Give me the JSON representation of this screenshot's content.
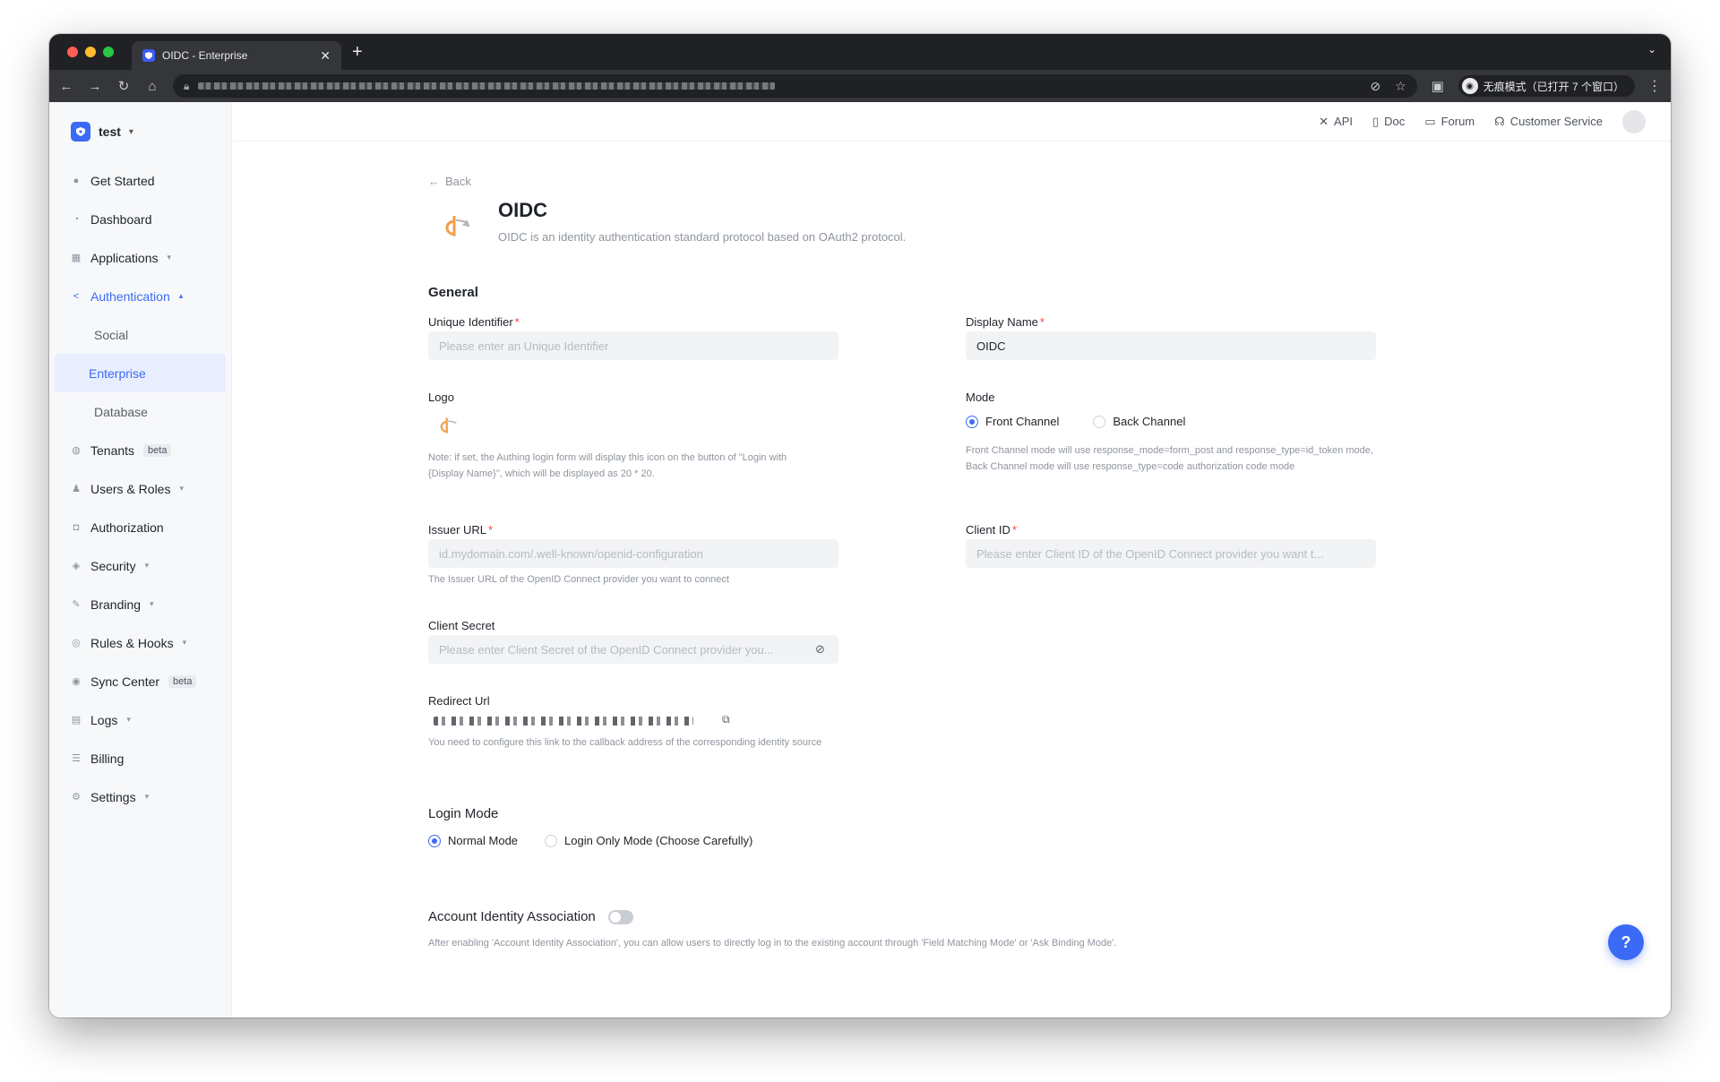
{
  "browser": {
    "tab_title": "OIDC - Enterprise",
    "profile_label": "无痕模式（已打开 7 个窗口）"
  },
  "sidebar": {
    "org_name": "test",
    "items": [
      {
        "label": "Get Started"
      },
      {
        "label": "Dashboard"
      },
      {
        "label": "Applications"
      },
      {
        "label": "Authentication"
      },
      {
        "label": "Social"
      },
      {
        "label": "Enterprise"
      },
      {
        "label": "Database"
      },
      {
        "label": "Tenants",
        "badge": "beta"
      },
      {
        "label": "Users & Roles"
      },
      {
        "label": "Authorization"
      },
      {
        "label": "Security"
      },
      {
        "label": "Branding"
      },
      {
        "label": "Rules & Hooks"
      },
      {
        "label": "Sync Center",
        "badge": "beta"
      },
      {
        "label": "Logs"
      },
      {
        "label": "Billing"
      },
      {
        "label": "Settings"
      }
    ]
  },
  "topbar": {
    "api": "API",
    "doc": "Doc",
    "forum": "Forum",
    "customer_service": "Customer Service"
  },
  "page": {
    "back": "Back",
    "title": "OIDC",
    "description": "OIDC is an identity authentication standard protocol based on OAuth2 protocol."
  },
  "general": {
    "section_title": "General",
    "unique_identifier_label": "Unique Identifier",
    "unique_identifier_placeholder": "Please enter an Unique Identifier",
    "display_name_label": "Display Name",
    "display_name_value": "OIDC",
    "logo_label": "Logo",
    "logo_note": "Note: if set, the Authing login form will display this icon on the button of \"Login with {Display Name}\", which will be displayed as 20 * 20.",
    "mode_label": "Mode",
    "mode_front": "Front Channel",
    "mode_back": "Back Channel",
    "mode_help": "Front Channel mode will use response_mode=form_post and response_type=id_token mode, Back Channel mode will use response_type=code authorization code mode",
    "issuer_label": "Issuer URL",
    "issuer_placeholder": "id.mydomain.com/.well-known/openid-configuration",
    "issuer_help": "The Issuer URL of the OpenID Connect provider you want to connect",
    "client_id_label": "Client ID",
    "client_id_placeholder": "Please enter Client ID of the OpenID Connect provider you want t...",
    "client_secret_label": "Client Secret",
    "client_secret_placeholder": "Please enter Client Secret of the OpenID Connect provider you...",
    "redirect_label": "Redirect Url",
    "redirect_help": "You need to configure this link to the callback address of the corresponding identity source"
  },
  "login_mode": {
    "section_title": "Login Mode",
    "normal": "Normal Mode",
    "login_only": "Login Only Mode (Choose Carefully)"
  },
  "account_assoc": {
    "title": "Account Identity Association",
    "help": "After enabling 'Account Identity Association', you can allow users to directly log in to the existing account through 'Field Matching Mode' or 'Ask Binding Mode'."
  },
  "help_fab": "?",
  "colors": {
    "accent": "#3b6af6",
    "required": "#f5483b"
  }
}
